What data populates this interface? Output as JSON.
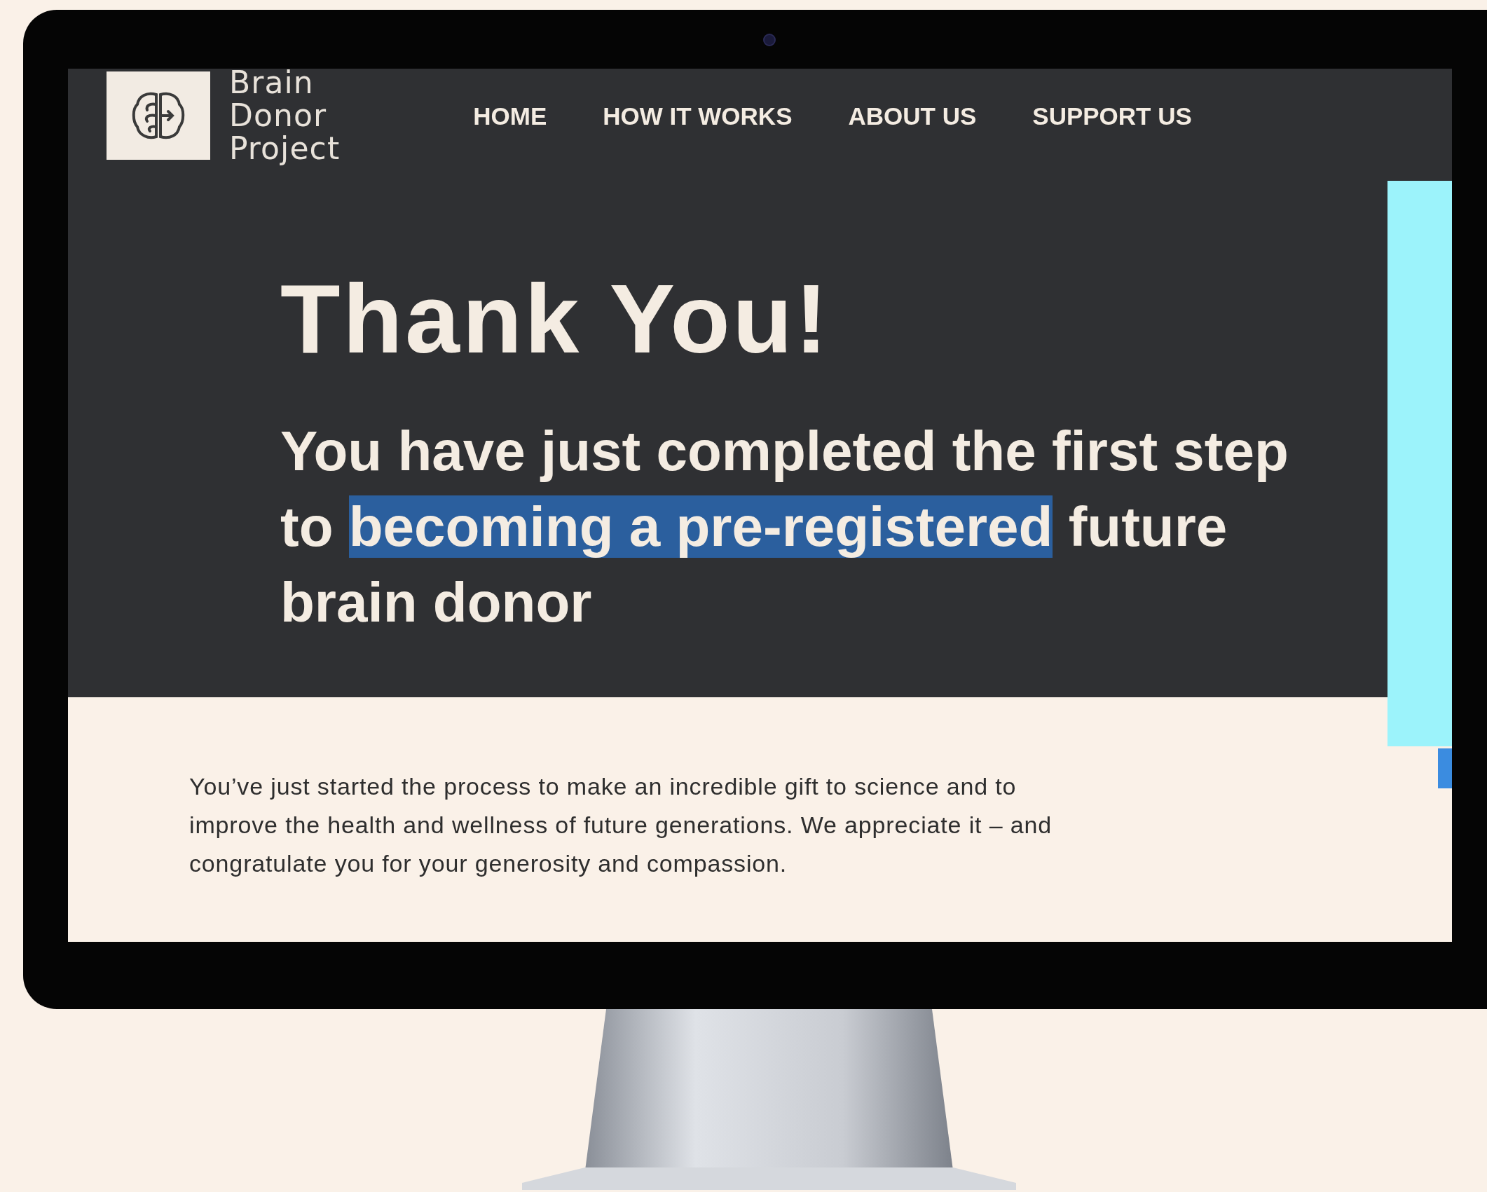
{
  "site": {
    "brand_lines": [
      "Brain",
      "Donor",
      "Project"
    ]
  },
  "nav": [
    {
      "label": "HOME"
    },
    {
      "label": "HOW IT WORKS"
    },
    {
      "label": "ABOUT US"
    },
    {
      "label": "SUPPORT US"
    }
  ],
  "hero": {
    "title": "Thank You!",
    "subtitle_before": "You have just completed the first step to ",
    "subtitle_highlight": "becoming a pre-registered",
    "subtitle_after": " future brain donor"
  },
  "body": {
    "paragraph": "You’ve just started the process to make an incredible gift to science and to improve the health and wellness of future generations. We appreciate it – and congratulate you for your generosity and compassion."
  }
}
